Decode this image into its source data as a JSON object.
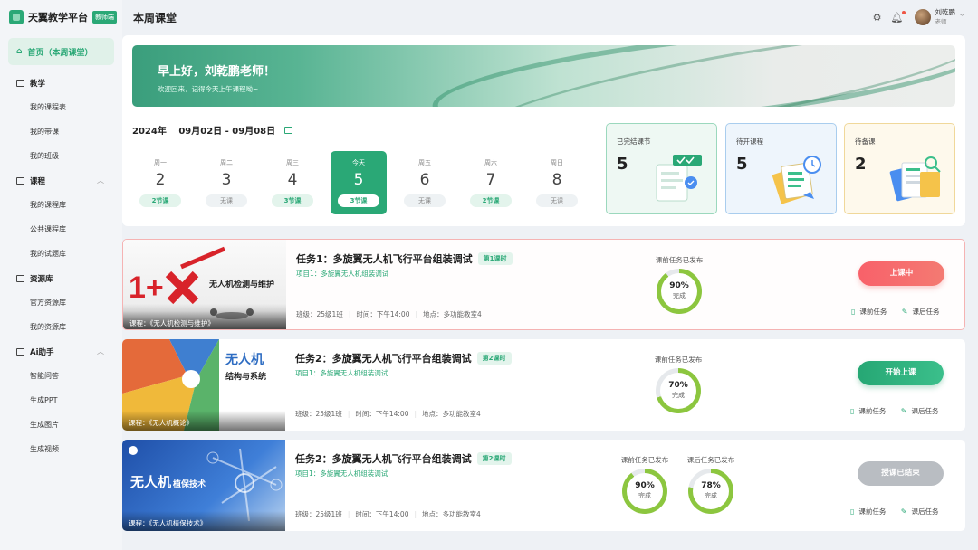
{
  "app": {
    "name": "天翼教学平台",
    "badge": "教师端"
  },
  "header": {
    "title": "本周课堂",
    "user": {
      "name": "刘乾鹏",
      "role": "老师"
    }
  },
  "sidebar": {
    "home": "首页（本周课堂）",
    "groups": [
      {
        "label": "教学",
        "items": [
          "我的课程表",
          "我的带课",
          "我的班级"
        ]
      },
      {
        "label": "课程",
        "items": [
          "我的课程库",
          "公共课程库",
          "我的试题库"
        ]
      },
      {
        "label": "资源库",
        "items": [
          "官方资源库",
          "我的资源库"
        ]
      },
      {
        "label": "Ai助手",
        "items": [
          "智能问答",
          "生成PPT",
          "生成图片",
          "生成视频"
        ]
      }
    ]
  },
  "banner": {
    "greeting": "早上好，刘乾鹏老师！",
    "sub": "欢迎回来，记得今天上午课程呦~"
  },
  "week": {
    "year": "2024年",
    "range": "09月02日 - 09月08日",
    "days": [
      {
        "name": "周一",
        "date": "2",
        "count": "2节课",
        "has": true,
        "today": false
      },
      {
        "name": "周二",
        "date": "3",
        "count": "无课",
        "has": false,
        "today": false
      },
      {
        "name": "周三",
        "date": "4",
        "count": "3节课",
        "has": true,
        "today": false
      },
      {
        "name": "今天",
        "date": "5",
        "count": "3节课",
        "has": true,
        "today": true
      },
      {
        "name": "周五",
        "date": "6",
        "count": "无课",
        "has": false,
        "today": false
      },
      {
        "name": "周六",
        "date": "7",
        "count": "2节课",
        "has": true,
        "today": false
      },
      {
        "name": "周日",
        "date": "8",
        "count": "无课",
        "has": false,
        "today": false
      }
    ]
  },
  "stats": [
    {
      "label": "已完结课节",
      "value": "5"
    },
    {
      "label": "待开课程",
      "value": "5"
    },
    {
      "label": "待备课",
      "value": "2"
    }
  ],
  "courses": [
    {
      "title": "任务1：多旋翼无人机飞行平台组装调试",
      "tag": "第1课时",
      "project": "项目1：多旋翼无人机组装调试",
      "class": "班级：25级1班",
      "time": "时间：下午14:00",
      "place": "地点：多功能教室4",
      "thumb_caption": "课程：《无人机检测与维护》",
      "thumb_title": "无人机检测与维护",
      "rings": [
        {
          "label": "课前任务已发布",
          "percent": 90,
          "value": "90%",
          "sub": "完成"
        }
      ],
      "button": "上课中",
      "state": "live",
      "link_pre": "课前任务",
      "link_post": "课后任务"
    },
    {
      "title": "任务2：多旋翼无人机飞行平台组装调试",
      "tag": "第2课时",
      "project": "项目1：多旋翼无人机组装调试",
      "class": "班级：25级1班",
      "time": "时间：下午14:00",
      "place": "地点：多功能教室4",
      "thumb_caption": "课程：《无人机概论》",
      "thumb_title": "无人机",
      "thumb_sub": "结构与系统",
      "rings": [
        {
          "label": "课前任务已发布",
          "percent": 70,
          "value": "70%",
          "sub": "完成"
        }
      ],
      "button": "开始上课",
      "state": "start",
      "link_pre": "课前任务",
      "link_post": "课后任务"
    },
    {
      "title": "任务2：多旋翼无人机飞行平台组装调试",
      "tag": "第2课时",
      "project": "项目1：多旋翼无人机组装调试",
      "class": "班级：25级1班",
      "time": "时间：下午14:00",
      "place": "地点：多功能教室4",
      "thumb_caption": "课程：《无人机植保技术》",
      "thumb_title": "无人机",
      "thumb_sub": "植保技术",
      "rings": [
        {
          "label": "课前任务已发布",
          "percent": 90,
          "value": "90%",
          "sub": "完成"
        },
        {
          "label": "课后任务已发布",
          "percent": 78,
          "value": "78%",
          "sub": "完成"
        }
      ],
      "button": "授课已结束",
      "state": "ended",
      "link_pre": "课前任务",
      "link_post": "课后任务"
    }
  ],
  "colors": {
    "accent": "#2aa876",
    "live": "#f8616a",
    "ended": "#b9bdc2"
  }
}
